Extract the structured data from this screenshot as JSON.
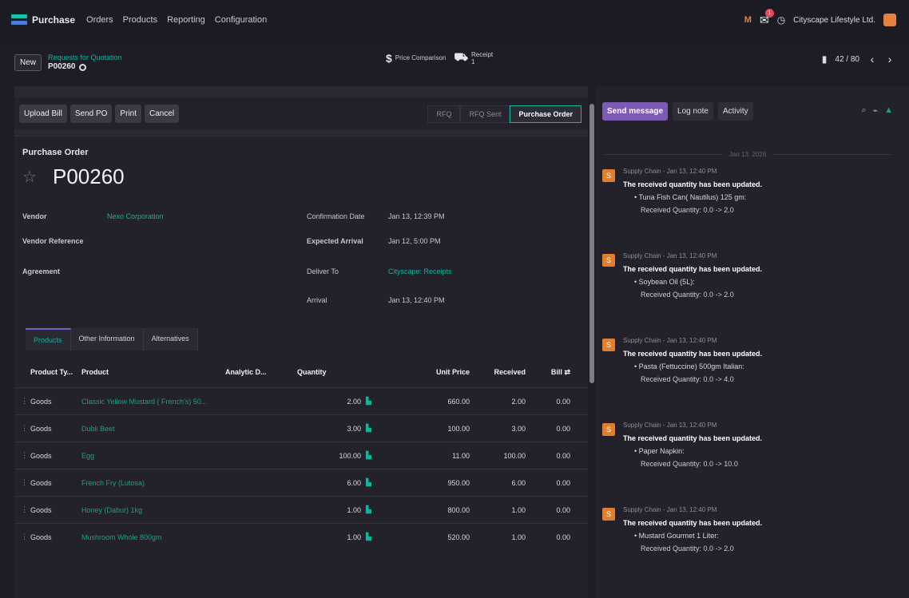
{
  "topbar": {
    "app_name": "Purchase",
    "menu": [
      "Orders",
      "Products",
      "Reporting",
      "Configuration"
    ],
    "user_initials": "M",
    "messages_count": "1",
    "company": "Cityscape Lifestyle Ltd."
  },
  "breadcrumb": {
    "new_label": "New",
    "parent": "Requests for Quotation",
    "current": "P00260"
  },
  "smart_buttons": {
    "price_comparison": "Price Comparison",
    "receipt": "Receipt",
    "receipt_count": "1"
  },
  "pager": {
    "text": "42 / 80"
  },
  "actions": [
    "Upload Bill",
    "Send PO",
    "Print",
    "Cancel"
  ],
  "stages": [
    "RFQ",
    "RFQ Sent",
    "Purchase Order"
  ],
  "form": {
    "title_label": "Purchase Order",
    "number": "P00260",
    "vendor_label": "Vendor",
    "vendor_value": "Nexo Corporation",
    "vendor_ref_label": "Vendor Reference",
    "agreement_label": "Agreement",
    "confirmation_label": "Confirmation Date",
    "confirmation_value": "Jan 13, 12:39 PM",
    "expected_label": "Expected Arrival",
    "expected_value": "Jan 12, 5:00 PM",
    "deliver_label": "Deliver To",
    "deliver_value": "Cityscape: Receipts",
    "arrival_label": "Arrival",
    "arrival_value": "Jan 13, 12:40 PM"
  },
  "tabs": [
    "Products",
    "Other Information",
    "Alternatives"
  ],
  "table": {
    "headers": [
      "Product Ty...",
      "Product",
      "Analytic D...",
      "Quantity",
      "Unit Price",
      "Received",
      "Bill"
    ],
    "rows": [
      [
        "Goods",
        "Classic Yellow Mustard ( French's) 50...",
        "",
        "2.00",
        "660.00",
        "2.00",
        "0.00"
      ],
      [
        "Goods",
        "Dubli Beet",
        "",
        "3.00",
        "100.00",
        "3.00",
        "0.00"
      ],
      [
        "Goods",
        "Egg",
        "",
        "100.00",
        "11.00",
        "100.00",
        "0.00"
      ],
      [
        "Goods",
        "French Fry (Lutosa)",
        "",
        "6.00",
        "950.00",
        "6.00",
        "0.00"
      ],
      [
        "Goods",
        "Honey (Dabur) 1kg",
        "",
        "1.00",
        "800.00",
        "1.00",
        "0.00"
      ],
      [
        "Goods",
        "Mushroom Whole 800gm",
        "",
        "1.00",
        "520.00",
        "1.00",
        "0.00"
      ]
    ]
  },
  "chatter": {
    "send_message": "Send message",
    "log_note": "Log note",
    "activity": "Activity",
    "date_separator": "Jan 13, 2026",
    "messages": [
      {
        "author": "Supply Chain - Jan 13, 12:40 PM",
        "title": "The received quantity has been updated.",
        "item": "Tuna Fish Can( Nautilus) 125 gm:",
        "change": "Received Quantity: 0.0 -> 2.0"
      },
      {
        "author": "Supply Chain - Jan 13, 12:40 PM",
        "title": "The received quantity has been updated.",
        "item": "Soybean Oil (5L):",
        "change": "Received Quantity: 0.0 -> 2.0"
      },
      {
        "author": "Supply Chain - Jan 13, 12:40 PM",
        "title": "The received quantity has been updated.",
        "item": "Pasta (Fettuccine) 500gm Italian:",
        "change": "Received Quantity: 0.0 -> 4.0"
      },
      {
        "author": "Supply Chain - Jan 13, 12:40 PM",
        "title": "The received quantity has been updated.",
        "item": "Paper Napkin:",
        "change": "Received Quantity: 0.0 -> 10.0"
      },
      {
        "author": "Supply Chain - Jan 13, 12:40 PM",
        "title": "The received quantity has been updated.",
        "item": "Mustard Gourmet 1 Liter:",
        "change": "Received Quantity: 0.0 -> 2.0"
      }
    ]
  }
}
